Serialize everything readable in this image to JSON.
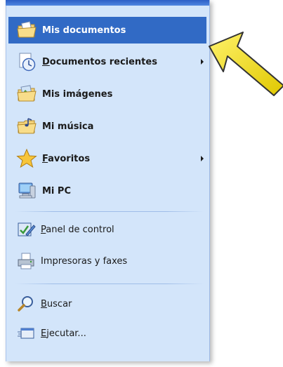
{
  "menu": {
    "items": [
      {
        "key": "mis-documentos",
        "label": "Mis documentos",
        "mnemonic": "",
        "bold": true,
        "selected": true,
        "submenu": false,
        "icon": "folder-documents-icon"
      },
      {
        "key": "documentos-recientes",
        "label_pre": "",
        "label_u": "D",
        "label_post": "ocumentos recientes",
        "bold": true,
        "selected": false,
        "submenu": true,
        "icon": "recent-documents-icon"
      },
      {
        "key": "mis-imagenes",
        "label": "Mis imágenes",
        "bold": true,
        "selected": false,
        "submenu": false,
        "icon": "folder-pictures-icon"
      },
      {
        "key": "mi-musica",
        "label": "Mi música",
        "bold": true,
        "selected": false,
        "submenu": false,
        "icon": "folder-music-icon"
      },
      {
        "key": "favoritos",
        "label_pre": "",
        "label_u": "F",
        "label_post": "avoritos",
        "bold": true,
        "selected": false,
        "submenu": true,
        "icon": "favorites-star-icon"
      },
      {
        "key": "mi-pc",
        "label": "Mi PC",
        "bold": true,
        "selected": false,
        "submenu": false,
        "icon": "my-computer-icon"
      },
      {
        "key": "panel-de-control",
        "label_pre": "",
        "label_u": "P",
        "label_post": "anel de control",
        "bold": false,
        "selected": false,
        "submenu": false,
        "icon": "control-panel-icon"
      },
      {
        "key": "impresoras-y-faxes",
        "label": "Impresoras y faxes",
        "bold": false,
        "selected": false,
        "submenu": false,
        "icon": "printer-icon"
      },
      {
        "key": "buscar",
        "label_pre": "",
        "label_u": "B",
        "label_post": "uscar",
        "bold": false,
        "selected": false,
        "submenu": false,
        "icon": "search-magnifier-icon"
      },
      {
        "key": "ejecutar",
        "label_pre": "",
        "label_u": "E",
        "label_post": "jecutar...",
        "bold": false,
        "selected": false,
        "submenu": false,
        "icon": "run-icon"
      }
    ]
  },
  "colors": {
    "panel_bg": "#d3e5fa",
    "selected_bg": "#316ac5",
    "selected_text": "#ffffff",
    "arrow_fill": "#f2e600",
    "arrow_stroke": "#333333"
  },
  "pointer": {
    "icon": "yellow-arrow-pointer-icon"
  }
}
